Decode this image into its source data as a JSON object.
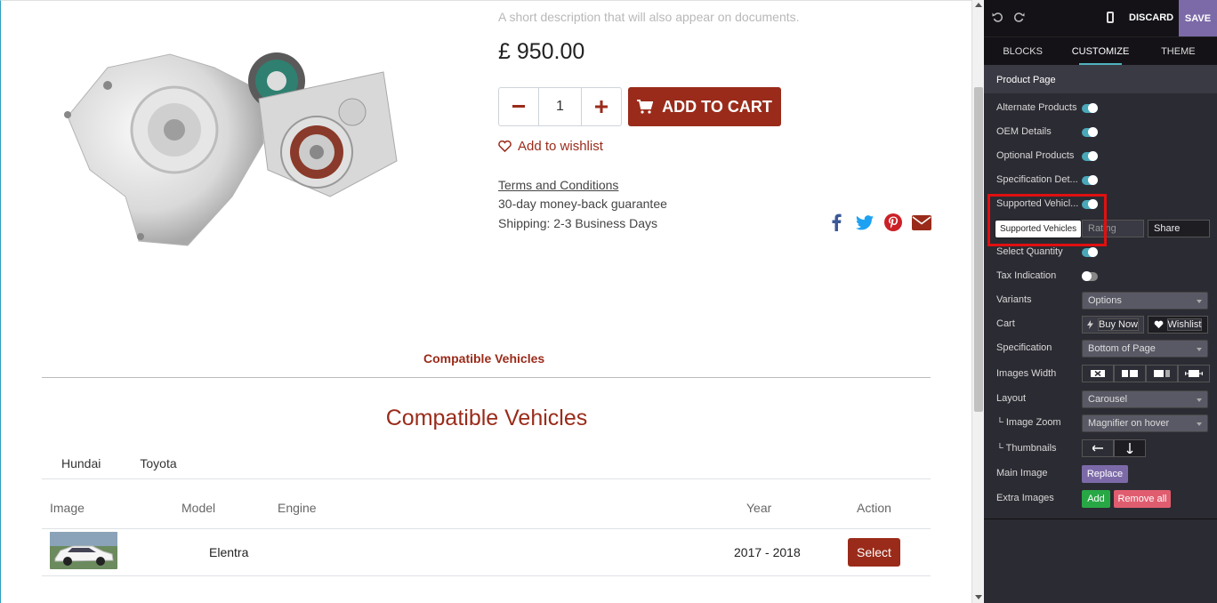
{
  "product": {
    "description_placeholder": "A short description that will also appear on documents.",
    "price": "£ 950.00",
    "quantity": "1",
    "add_to_cart": "ADD TO CART",
    "wishlist": "Add to wishlist",
    "terms": "Terms and Conditions",
    "guarantee": "30-day money-back guarantee",
    "shipping": "Shipping: 2-3 Business Days"
  },
  "compat": {
    "tab_label": "Compatible Vehicles",
    "title": "Compatible Vehicles",
    "brands": [
      "Hundai",
      "Toyota"
    ],
    "columns": [
      "Image",
      "Model",
      "Engine",
      "Year",
      "Action"
    ],
    "rows": [
      {
        "model": "Elentra",
        "engine": "",
        "year": "2017 - 2018",
        "action": "Select"
      }
    ]
  },
  "panel": {
    "discard": "DISCARD",
    "save": "SAVE",
    "tabs": [
      "BLOCKS",
      "CUSTOMIZE",
      "THEME"
    ],
    "section_title": "Product Page",
    "options": {
      "alternate_products": "Alternate Products",
      "oem_details": "OEM Details",
      "optional_products": "Optional Products",
      "specification_details": "Specification Det...",
      "supported_vehicles": "Supported Vehicl...",
      "rating": "Rating",
      "share": "Share",
      "select_quantity": "Select Quantity",
      "tax_indication": "Tax Indication",
      "variants": "Variants",
      "variants_value": "Options",
      "cart": "Cart",
      "buy_now": "Buy Now",
      "wishlist": "Wishlist",
      "specification": "Specification",
      "specification_value": "Bottom of Page",
      "images_width": "Images Width",
      "layout": "Layout",
      "layout_value": "Carousel",
      "image_zoom": "└ Image Zoom",
      "image_zoom_value": "Magnifier on hover",
      "thumbnails": "└ Thumbnails",
      "main_image": "Main Image",
      "replace": "Replace",
      "extra_images": "Extra Images",
      "add": "Add",
      "remove_all": "Remove all"
    },
    "tooltip": "Supported Vehicles"
  },
  "colors": {
    "brand": "#9a2b1a",
    "panel_bg": "#2b2b33",
    "accent": "#7c6aa8",
    "toggle_on": "#48a8b8"
  }
}
